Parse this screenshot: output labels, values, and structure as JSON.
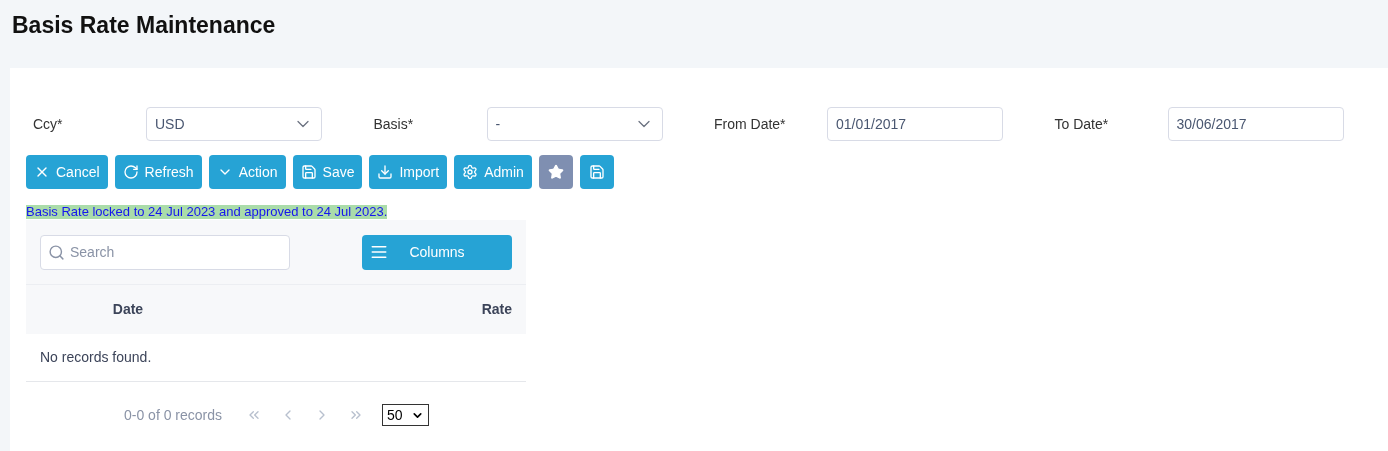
{
  "page_title": "Basis Rate Maintenance",
  "filters": [
    {
      "label": "Ccy*",
      "kind": "select",
      "value": "USD"
    },
    {
      "label": "Basis*",
      "kind": "select",
      "value": "-"
    },
    {
      "label": "From Date*",
      "kind": "date",
      "value": "01/01/2017"
    },
    {
      "label": "To Date*",
      "kind": "date",
      "value": "30/06/2017"
    }
  ],
  "toolbar": [
    {
      "label": "Cancel",
      "disabled": false
    },
    {
      "label": "Refresh",
      "disabled": false
    },
    {
      "label": "Action",
      "disabled": false
    },
    {
      "label": "Save",
      "disabled": false
    },
    {
      "label": "Import",
      "disabled": false
    },
    {
      "label": "Admin",
      "disabled": false
    },
    {
      "disabled": true
    },
    {
      "disabled": false
    }
  ],
  "lock_message": "Basis Rate locked to 24 Jul 2023 and approved to 24 Jul 2023.",
  "table": {
    "search": {
      "placeholder": "Search"
    },
    "columns_button": "Columns",
    "columns": [
      "Date",
      "Rate"
    ],
    "empty_message": "No records found.",
    "pagination": {
      "summary": "0-0 of 0 records",
      "page_size": "50"
    }
  }
}
